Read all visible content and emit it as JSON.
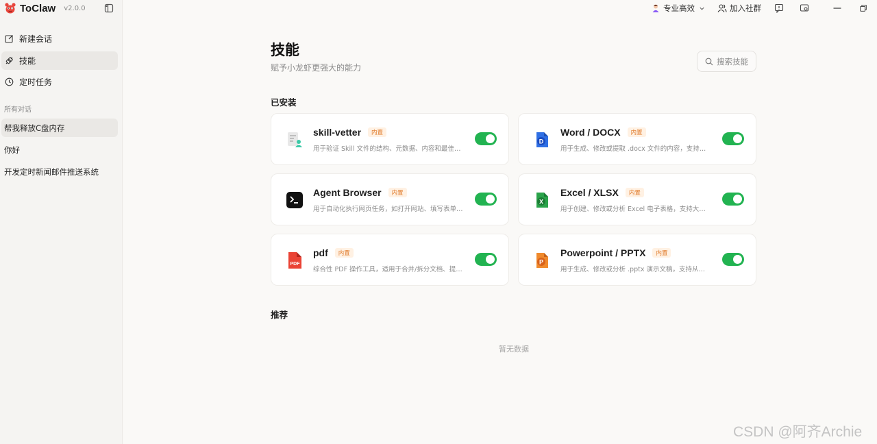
{
  "app": {
    "name": "ToClaw",
    "version": "v2.0.0"
  },
  "sidebar": {
    "nav": [
      {
        "label": "新建会话",
        "icon": "edit-icon"
      },
      {
        "label": "技能",
        "icon": "plug-icon"
      },
      {
        "label": "定时任务",
        "icon": "clock-icon"
      }
    ],
    "section_title": "所有对话",
    "conversations": [
      {
        "label": "帮我释放C盘内存"
      },
      {
        "label": "你好"
      },
      {
        "label": "开发定时新闻邮件推送系统"
      }
    ]
  },
  "topbar": {
    "mode_label": "专业高效",
    "community_label": "加入社群"
  },
  "main": {
    "title": "技能",
    "subtitle": "赋予小龙虾更强大的能力",
    "search_placeholder": "搜索技能",
    "installed_title": "已安装",
    "recommended_title": "推荐",
    "empty_text": "暂无数据"
  },
  "skills": [
    {
      "name": "skill-vetter",
      "badge": "内置",
      "desc": "用于验证 Skill 文件的结构、元数据、内容和最佳实践",
      "enabled": true,
      "icon": "skill-vetter-icon"
    },
    {
      "name": "Word / DOCX",
      "badge": "内置",
      "desc": "用于生成、修改或提取 .docx 文件的内容，支持从头创建",
      "enabled": true,
      "icon": "word-icon"
    },
    {
      "name": "Agent Browser",
      "badge": "内置",
      "desc": "用于自动化执行网页任务，如打开网站、填写表单、点击按钮",
      "enabled": true,
      "icon": "terminal-icon"
    },
    {
      "name": "Excel / XLSX",
      "badge": "内置",
      "desc": "用于创建、修改或分析 Excel 电子表格，支持大规模数据",
      "enabled": true,
      "icon": "excel-icon"
    },
    {
      "name": "pdf",
      "badge": "内置",
      "desc": "综合性 PDF 操作工具，适用于合并/拆分文档、提取文本",
      "enabled": true,
      "icon": "pdf-icon"
    },
    {
      "name": "Powerpoint / PPTX",
      "badge": "内置",
      "desc": "用于生成、修改或分析 .pptx 演示文稿，支持从头构建",
      "enabled": true,
      "icon": "ppt-icon"
    }
  ],
  "watermark": "CSDN @阿齐Archie",
  "colors": {
    "toggle_on": "#22b351",
    "badge_text": "#e07a2a",
    "badge_bg": "#fff1e3"
  }
}
